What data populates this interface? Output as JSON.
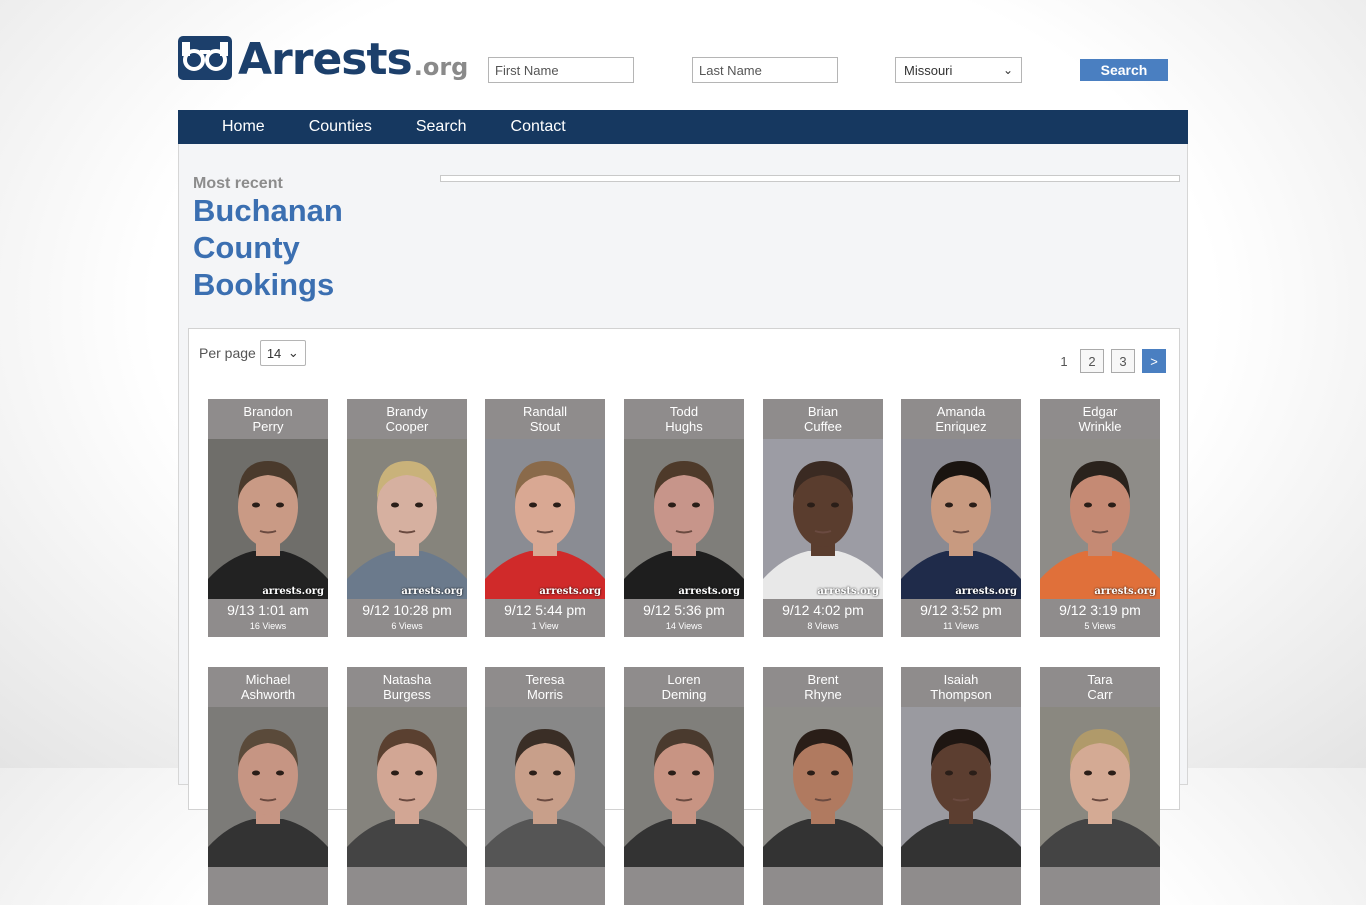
{
  "header": {
    "logo_main": "Arrests",
    "logo_tld": ".org",
    "first_name_placeholder": "First Name",
    "last_name_placeholder": "Last Name",
    "state_selected": "Missouri",
    "search_label": "Search"
  },
  "nav": {
    "items": [
      "Home",
      "Counties",
      "Search",
      "Contact"
    ]
  },
  "main": {
    "most_recent": "Most recent",
    "title_lines": [
      "Buchanan",
      "County",
      "Bookings"
    ]
  },
  "list": {
    "per_page_label": "Per page",
    "per_page_value": "14",
    "pages": [
      "1",
      "2",
      "3"
    ],
    "next": ">"
  },
  "watermark": "arrests.org",
  "colors": {
    "nav_bg": "#163860",
    "accent": "#4a7fc1",
    "title": "#3b6fb1",
    "card_bg": "#8f8c8c"
  },
  "cards": [
    {
      "first": "Brandon",
      "last": "Perry",
      "date": "9/13 1:01 am",
      "views": "16 Views",
      "bg": "#6f6e6a",
      "skin": "#c99a85",
      "hair": "#4a3a2c",
      "shirt": "#222222"
    },
    {
      "first": "Brandy",
      "last": "Cooper",
      "date": "9/12 10:28 pm",
      "views": "6 Views",
      "bg": "#86847c",
      "skin": "#d6b0a0",
      "hair": "#c9b27a",
      "shirt": "#6b7a8c"
    },
    {
      "first": "Randall",
      "last": "Stout",
      "date": "9/12 5:44 pm",
      "views": "1 View",
      "bg": "#8a8c93",
      "skin": "#d9a893",
      "hair": "#8a6a4a",
      "shirt": "#d02a2a"
    },
    {
      "first": "Todd",
      "last": "Hughs",
      "date": "9/12 5:36 pm",
      "views": "14 Views",
      "bg": "#7f7e7a",
      "skin": "#c7958a",
      "hair": "#4e3a2a",
      "shirt": "#1e1e1e"
    },
    {
      "first": "Brian",
      "last": "Cuffee",
      "date": "9/12 4:02 pm",
      "views": "8 Views",
      "bg": "#9c9ca4",
      "skin": "#5a3d2e",
      "hair": "#3a2a22",
      "shirt": "#e8e8e8"
    },
    {
      "first": "Amanda",
      "last": "Enriquez",
      "date": "9/12 3:52 pm",
      "views": "11 Views",
      "bg": "#8a8a92",
      "skin": "#c89a80",
      "hair": "#1a1410",
      "shirt": "#1f2b4a"
    },
    {
      "first": "Edgar",
      "last": "Wrinkle",
      "date": "9/12 3:19 pm",
      "views": "5 Views",
      "bg": "#8e8c88",
      "skin": "#c58a74",
      "hair": "#2a221c",
      "shirt": "#e0703a"
    },
    {
      "first": "Michael",
      "last": "Ashworth",
      "bg": "#7c7b78",
      "skin": "#c69583",
      "hair": "#5a4a3a",
      "shirt": "#333333"
    },
    {
      "first": "Natasha",
      "last": "Burgess",
      "bg": "#85837d",
      "skin": "#d2a694",
      "hair": "#5a4030",
      "shirt": "#444444"
    },
    {
      "first": "Teresa",
      "last": "Morris",
      "bg": "#888888",
      "skin": "#c89f8a",
      "hair": "#3a2e26",
      "shirt": "#555555"
    },
    {
      "first": "Loren",
      "last": "Deming",
      "bg": "#807f7b",
      "skin": "#c89483",
      "hair": "#4a3a2e",
      "shirt": "#333333"
    },
    {
      "first": "Brent",
      "last": "Rhyne",
      "bg": "#8f8e8a",
      "skin": "#b07a60",
      "hair": "#2a1e18",
      "shirt": "#333333"
    },
    {
      "first": "Isaiah",
      "last": "Thompson",
      "bg": "#9a9aa0",
      "skin": "#5c3e30",
      "hair": "#1e1612",
      "shirt": "#333333"
    },
    {
      "first": "Tara",
      "last": "Carr",
      "bg": "#8a8880",
      "skin": "#d4aa94",
      "hair": "#b09a6a",
      "shirt": "#444444"
    }
  ]
}
